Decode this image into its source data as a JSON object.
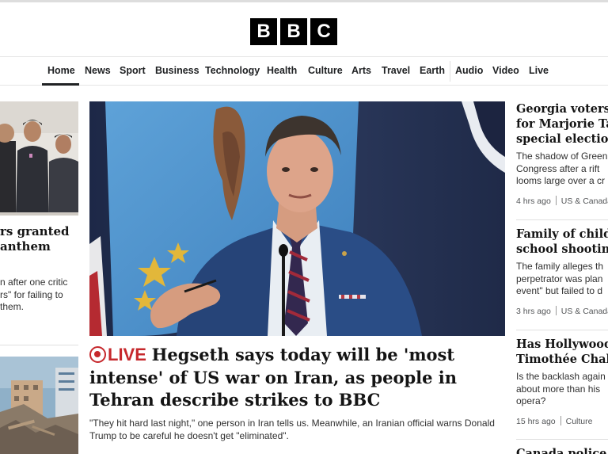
{
  "brand": {
    "letters": [
      "B",
      "B",
      "C"
    ]
  },
  "nav": {
    "items": [
      {
        "label": "Home",
        "active": true
      },
      {
        "label": "News"
      },
      {
        "label": "Sport"
      },
      {
        "label": "Business"
      },
      {
        "label": "Technology"
      },
      {
        "label": "Health"
      },
      {
        "label": "Culture"
      },
      {
        "label": "Arts"
      },
      {
        "label": "Travel"
      },
      {
        "label": "Earth"
      },
      {
        "label": "Audio"
      },
      {
        "label": "Video"
      },
      {
        "label": "Live"
      }
    ]
  },
  "left": {
    "headline": "rs granted\nanthem",
    "summary": "n after one critic\nrs\" for failing to\nthem."
  },
  "main": {
    "live_label": "LIVE",
    "headline": "Hegseth says today will be 'most intense' of US war on Iran, as people in Tehran describe strikes to BBC",
    "summary": "\"They hit hard last night,\" one person in Iran tells us. Meanwhile, an Iranian official warns Donald Trump to be careful he doesn't get \"eliminated\"."
  },
  "right": {
    "stories": [
      {
        "headline": "Georgia voters to\nfor Marjorie Tay\nspecial election",
        "summary": "The shadow of Green\nCongress after a rift\nlooms large over a cr",
        "time": "4 hrs ago",
        "section": "US & Canada"
      },
      {
        "headline": "Family of child in\nschool shooting",
        "summary": "The family alleges th\nperpetrator was plan\nevent\" but failed to d",
        "time": "3 hrs ago",
        "section": "US & Canada"
      },
      {
        "headline": "Has Hollywood g\nTimothée Chalam",
        "summary": "Is the backlash again\nabout more than his\nopera?",
        "time": "15 hrs ago",
        "section": "Culture"
      },
      {
        "headline": "Canada police in",
        "summary": "",
        "time": "",
        "section": ""
      }
    ]
  },
  "colors": {
    "live_red": "#c6282c",
    "text": "#141414",
    "nav_text": "#202224"
  }
}
